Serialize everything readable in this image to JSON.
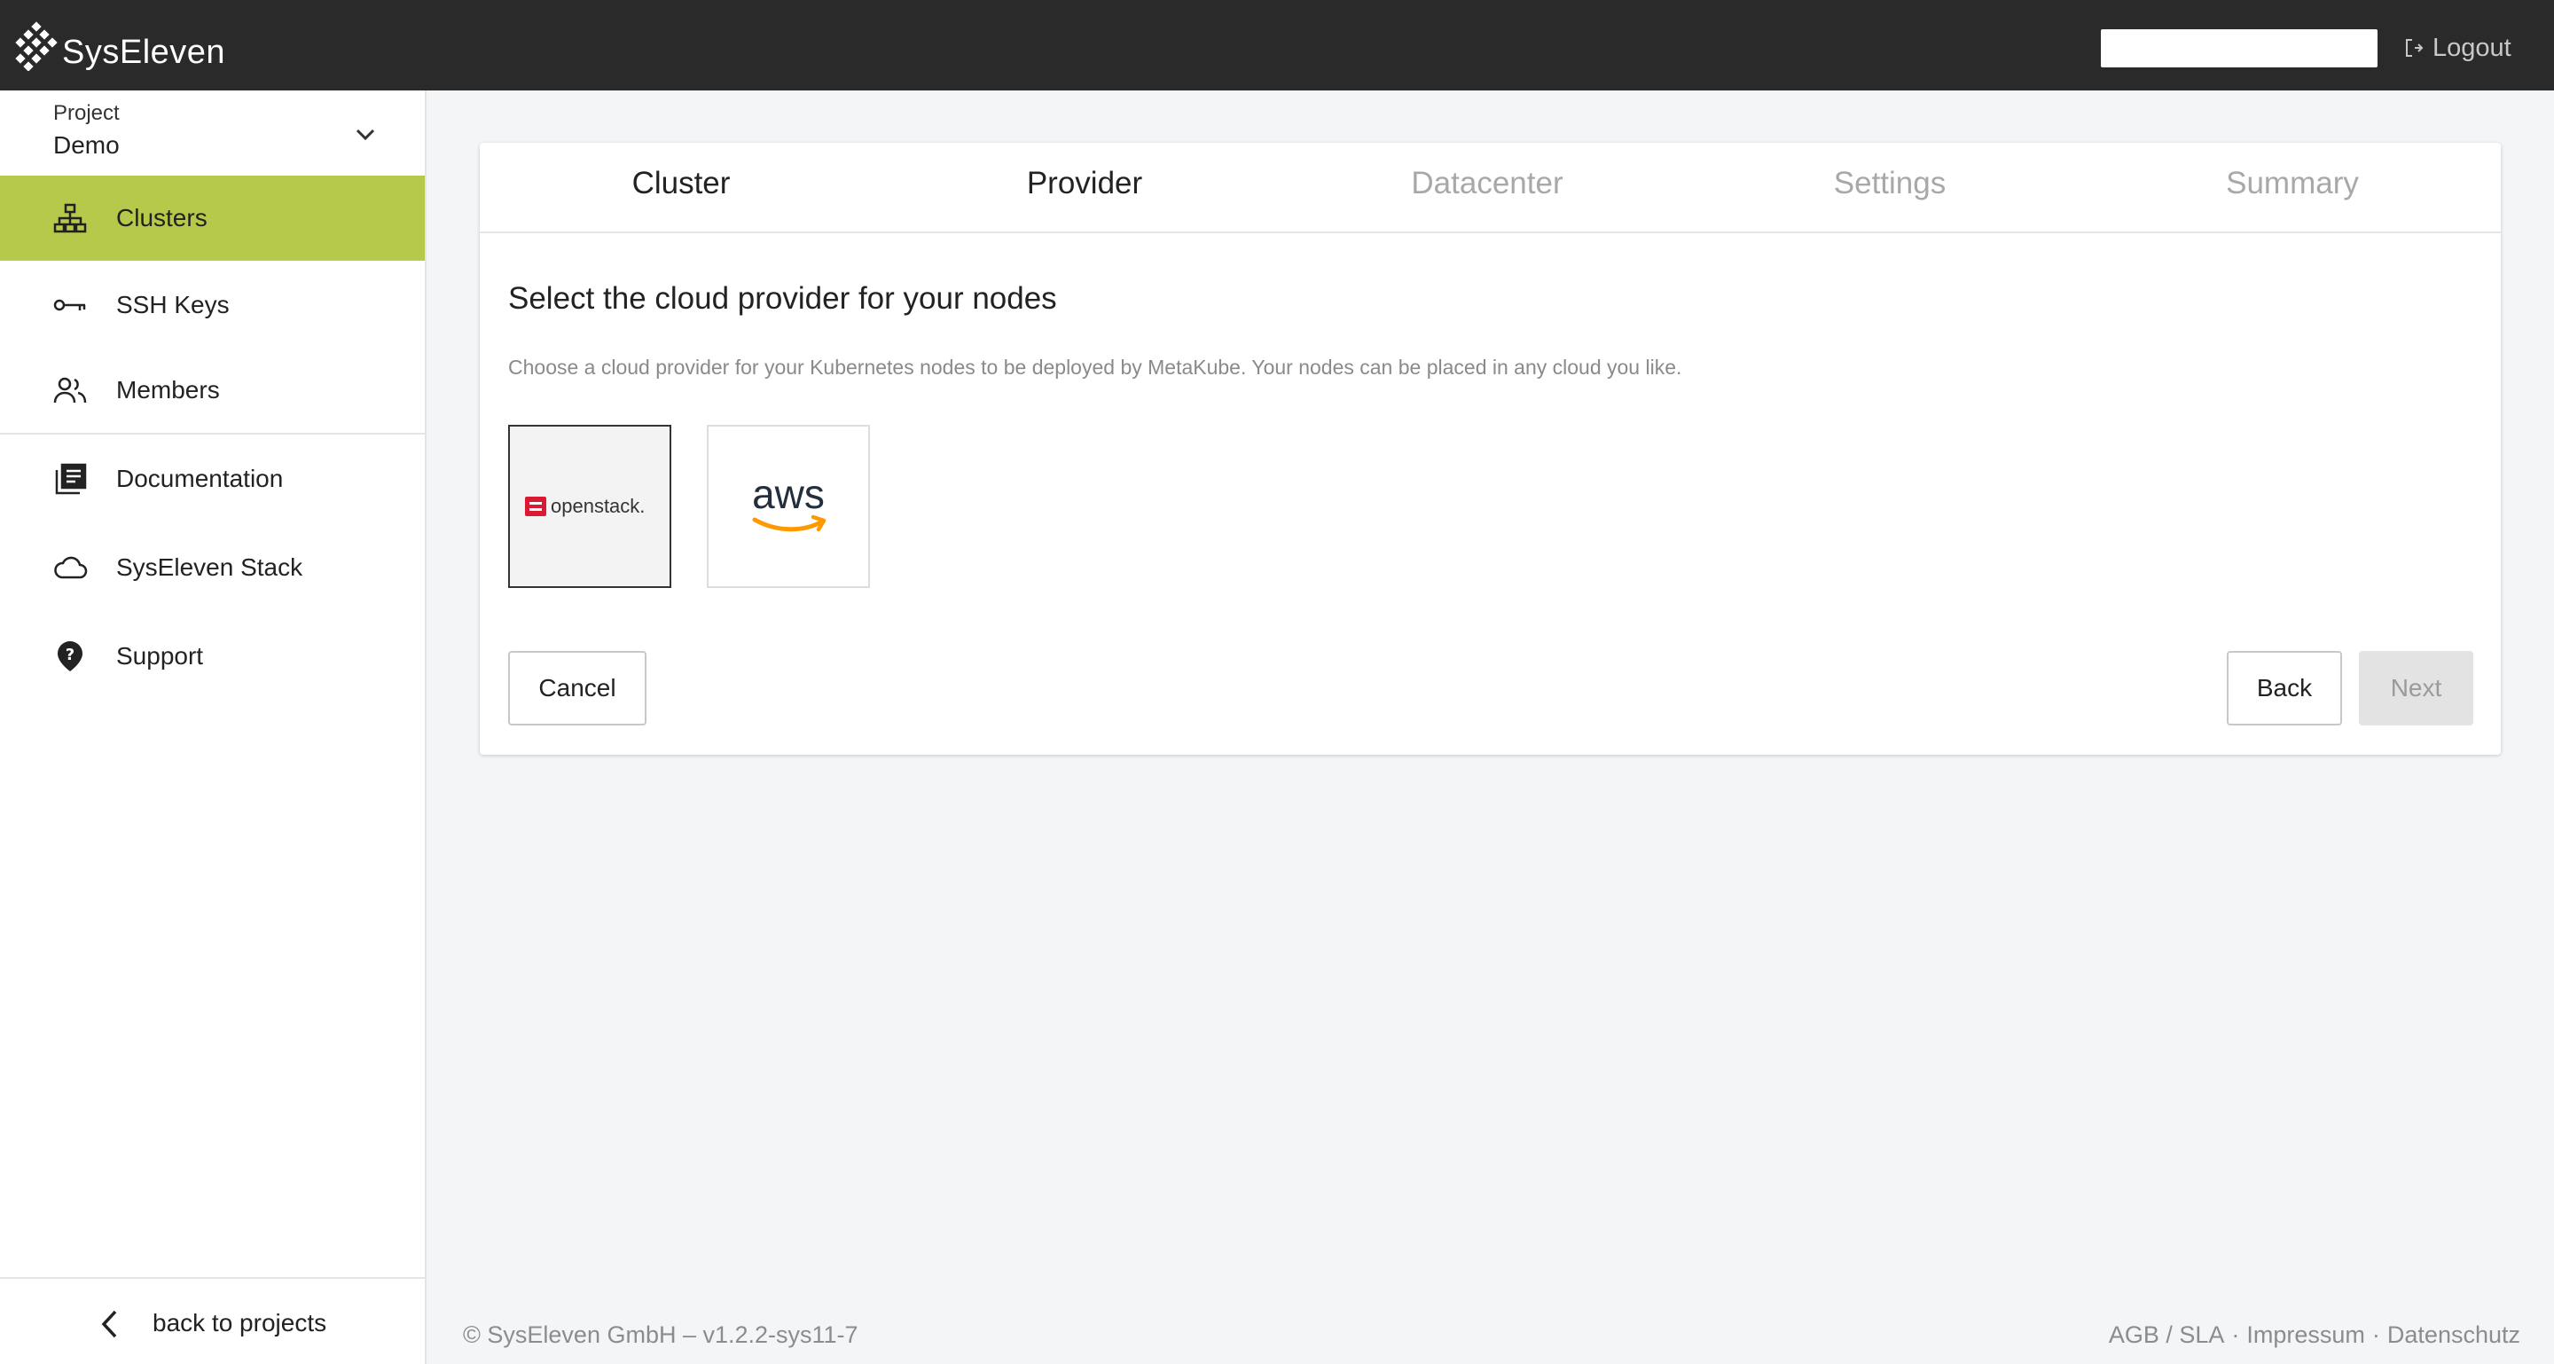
{
  "header": {
    "brand": "SysEleven",
    "search_value": "",
    "logout_label": "Logout"
  },
  "sidebar": {
    "project_label": "Project",
    "project_value": "Demo",
    "items": [
      {
        "label": "Clusters",
        "icon": "sitemap-icon",
        "active": true
      },
      {
        "label": "SSH Keys",
        "icon": "key-icon",
        "active": false
      },
      {
        "label": "Members",
        "icon": "members-icon",
        "active": false
      },
      {
        "label": "Documentation",
        "icon": "documentation-icon",
        "active": false
      },
      {
        "label": "SysEleven Stack",
        "icon": "cloud-icon",
        "active": false
      },
      {
        "label": "Support",
        "icon": "help-icon",
        "active": false
      }
    ],
    "back_label": "back to projects"
  },
  "wizard": {
    "steps": [
      {
        "label": "Cluster",
        "state": "done"
      },
      {
        "label": "Provider",
        "state": "current"
      },
      {
        "label": "Datacenter",
        "state": "pending"
      },
      {
        "label": "Settings",
        "state": "pending"
      },
      {
        "label": "Summary",
        "state": "pending"
      }
    ],
    "title": "Select the cloud provider for your nodes",
    "description": "Choose a cloud provider for your Kubernetes nodes to be deployed by MetaKube. Your nodes can be placed in any cloud you like.",
    "providers": [
      {
        "name": "openstack",
        "logo_text": "openstack.",
        "selected": true
      },
      {
        "name": "aws",
        "logo_text": "aws",
        "selected": false
      }
    ],
    "cancel_label": "Cancel",
    "back_label": "Back",
    "next_label": "Next"
  },
  "footer": {
    "copyright": "© SysEleven GmbH  –  v1.2.2-sys11-7",
    "links": [
      "AGB / SLA",
      "Impressum",
      "Datenschutz"
    ]
  },
  "colors": {
    "topbar": "#2a2a2a",
    "accent": "#b7c94a",
    "openstack_red": "#da1a32",
    "aws_orange": "#ff9900"
  }
}
